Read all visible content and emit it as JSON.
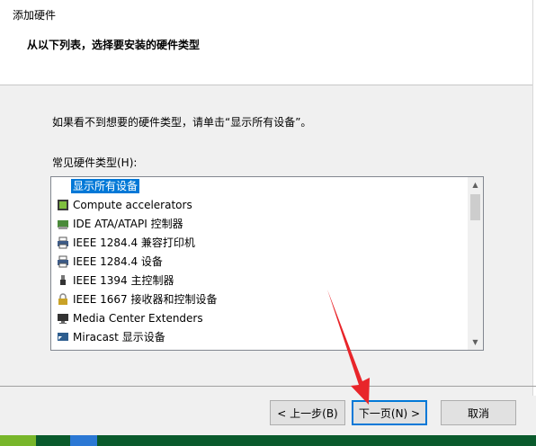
{
  "window": {
    "title": "添加硬件",
    "subtitle": "从以下列表，选择要安装的硬件类型"
  },
  "body": {
    "instruction": "如果看不到想要的硬件类型，请单击“显示所有设备”。",
    "list_label": "常见硬件类型(H):"
  },
  "hardware_list": {
    "items": [
      {
        "label": "显示所有设备",
        "icon": "blank-icon",
        "selected": true
      },
      {
        "label": "Compute accelerators",
        "icon": "chip-icon"
      },
      {
        "label": "IDE ATA/ATAPI 控制器",
        "icon": "ide-controller-icon"
      },
      {
        "label": "IEEE 1284.4 兼容打印机",
        "icon": "printer-icon"
      },
      {
        "label": "IEEE 1284.4 设备",
        "icon": "printer-icon"
      },
      {
        "label": "IEEE 1394 主控制器",
        "icon": "usb-plug-icon"
      },
      {
        "label": "IEEE 1667 接收器和控制设备",
        "icon": "lock-device-icon"
      },
      {
        "label": "Media Center Extenders",
        "icon": "monitor-icon"
      },
      {
        "label": "Miracast 显示设备",
        "icon": "miracast-icon"
      }
    ]
  },
  "buttons": {
    "back": "< 上一步(B)",
    "next": "下一页(N) >",
    "cancel": "取消"
  },
  "colors": {
    "selection": "#0078d7",
    "annotation_arrow": "#e8252a"
  }
}
